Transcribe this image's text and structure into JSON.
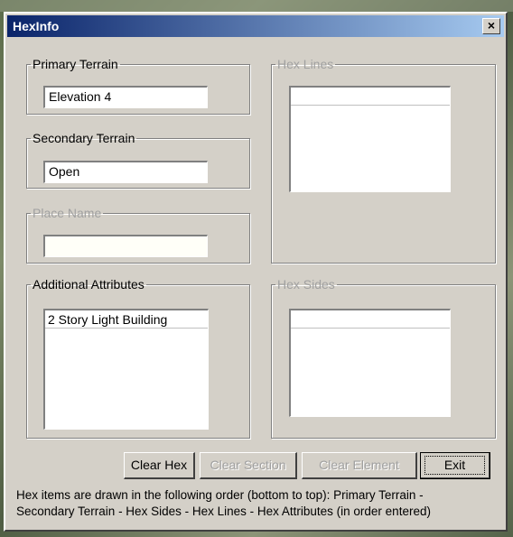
{
  "window": {
    "title": "HexInfo",
    "close_label": "×"
  },
  "primary_terrain": {
    "legend": "Primary Terrain",
    "value": "Elevation 4"
  },
  "secondary_terrain": {
    "legend": "Secondary Terrain",
    "value": "Open"
  },
  "place_name": {
    "legend": "Place Name",
    "value": ""
  },
  "additional_attributes": {
    "legend": "Additional Attributes",
    "items": [
      "2 Story Light Building"
    ]
  },
  "hex_lines": {
    "legend": "Hex Lines",
    "items": [
      ""
    ]
  },
  "hex_sides": {
    "legend": "Hex Sides",
    "items": [
      ""
    ]
  },
  "buttons": {
    "clear_hex": "Clear Hex",
    "clear_section": "Clear Section",
    "clear_element": "Clear Element",
    "exit": "Exit"
  },
  "note": {
    "line1": "Hex items are drawn in the following order (bottom to top):  Primary Terrain -",
    "line2": "Secondary Terrain - Hex Sides - Hex Lines - Hex Attributes (in order entered)"
  }
}
